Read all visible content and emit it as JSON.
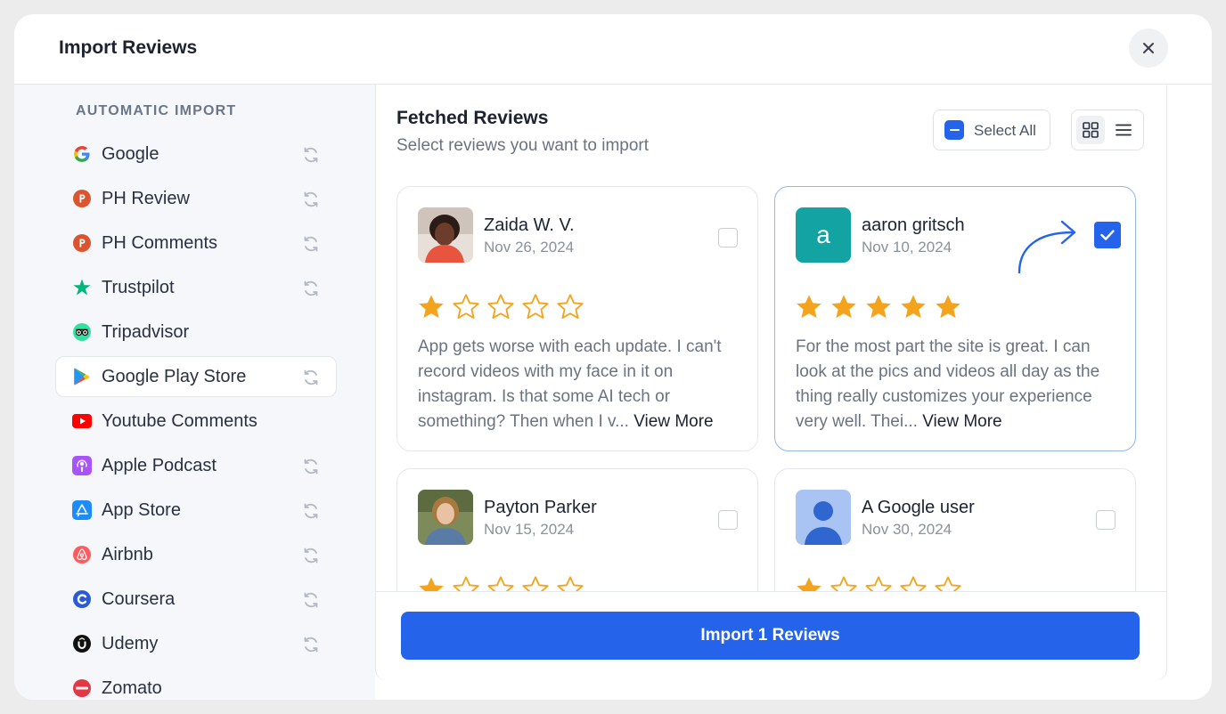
{
  "modal": {
    "title": "Import Reviews"
  },
  "sidebar": {
    "section_title": "AUTOMATIC IMPORT",
    "items": [
      {
        "label": "Google",
        "icon": "google-icon",
        "sync": true
      },
      {
        "label": "PH Review",
        "icon": "producthunt-icon",
        "sync": true
      },
      {
        "label": "PH Comments",
        "icon": "producthunt-icon",
        "sync": true
      },
      {
        "label": "Trustpilot",
        "icon": "trustpilot-star-icon",
        "sync": true
      },
      {
        "label": "Tripadvisor",
        "icon": "tripadvisor-icon",
        "sync": false
      },
      {
        "label": "Google Play Store",
        "icon": "google-play-icon",
        "sync": true,
        "active": true
      },
      {
        "label": "Youtube Comments",
        "icon": "youtube-icon",
        "sync": false
      },
      {
        "label": "Apple Podcast",
        "icon": "apple-podcast-icon",
        "sync": true
      },
      {
        "label": "App Store",
        "icon": "app-store-icon",
        "sync": true
      },
      {
        "label": "Airbnb",
        "icon": "airbnb-icon",
        "sync": true
      },
      {
        "label": "Coursera",
        "icon": "coursera-icon",
        "sync": true
      },
      {
        "label": "Udemy",
        "icon": "udemy-icon",
        "sync": true
      },
      {
        "label": "Zomato",
        "icon": "zomato-icon",
        "sync": false
      }
    ]
  },
  "content": {
    "title": "Fetched Reviews",
    "subtitle": "Select reviews you want to import",
    "select_all_label": "Select All",
    "view_mode": "grid"
  },
  "reviews": [
    {
      "name": "Zaida W. V.",
      "date": "Nov 26, 2024",
      "rating": 1,
      "text": "App gets worse with each update. I can't record videos with my face in it on instagram. Is that some AI tech or something? Then when I v...",
      "view_more": "View More",
      "selected": false,
      "avatar": "photo"
    },
    {
      "name": "aaron gritsch",
      "date": "Nov 10, 2024",
      "rating": 5,
      "text": "For the most part the site is great. I can look at the pics and videos all day as the thing really customizes your experience very well. Thei...",
      "view_more": "View More",
      "selected": true,
      "avatar": "initial",
      "initial": "a"
    },
    {
      "name": "Payton Parker",
      "date": "Nov 15, 2024",
      "rating": 1,
      "selected": false,
      "avatar": "photo"
    },
    {
      "name": "A Google user",
      "date": "Nov 30, 2024",
      "rating": 1,
      "selected": false,
      "avatar": "placeholder"
    }
  ],
  "footer": {
    "import_label": "Import 1 Reviews"
  },
  "colors": {
    "primary": "#2563eb",
    "star": "#f4a41c",
    "avatar_teal": "#14a3a3"
  }
}
